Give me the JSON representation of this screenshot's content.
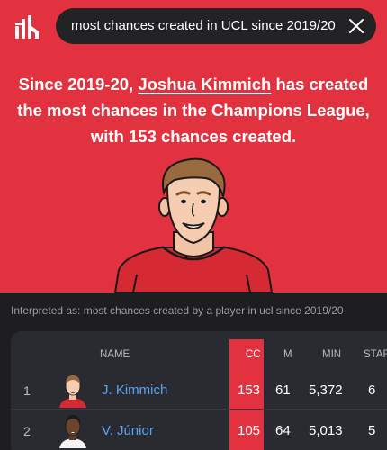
{
  "colors": {
    "accent": "#e2323f",
    "link": "#5aa1f2",
    "background": "#1e1e20",
    "card": "#2a2b30"
  },
  "header": {
    "logo_icon": "statmuse-logo-icon",
    "search_query": "most chances created in UCL since 2019/20",
    "close_icon": "close-icon"
  },
  "answer": {
    "part1": "Since 2019-20, ",
    "player": "Joshua Kimmich",
    "part2": " has created the most chances in the Champions League, with 153 chances created."
  },
  "interpretation": "Interpreted as: most chances created by a player in ucl since 2019/20",
  "table": {
    "columns": [
      "NAME",
      "CC",
      "M",
      "MIN",
      "STAR"
    ],
    "rows": [
      {
        "rank": "1",
        "name": "J. Kimmich",
        "cc": "153",
        "m": "61",
        "min": "5,372",
        "starts": "6"
      },
      {
        "rank": "2",
        "name": "V. Júnior",
        "cc": "105",
        "m": "64",
        "min": "5,013",
        "starts": "5"
      }
    ]
  }
}
